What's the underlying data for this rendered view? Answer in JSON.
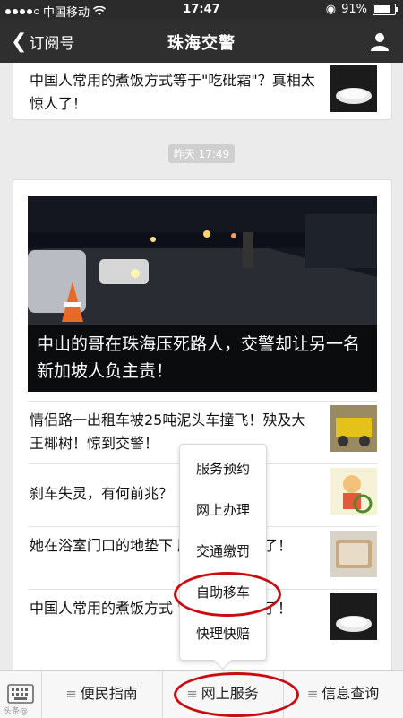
{
  "status_bar": {
    "carrier": "中国移动",
    "time": "17:47",
    "battery": "91%",
    "battery_level": 0.91
  },
  "navbar": {
    "back_label": "订阅号",
    "title": "珠海交警"
  },
  "top_card": {
    "title": "中国人常用的煮饭方式等于\"吃砒霜\"？真相太惊人了！"
  },
  "timestamp": "昨天 17:49",
  "hero": {
    "caption": "中山的哥在珠海压死路人，交警却让另一名新加坡人负主责！"
  },
  "articles": [
    {
      "title": "情侣路一出租车被25吨泥头车撞飞！殃及大王椰树！惊到交警！"
    },
    {
      "title": "刹车失灵，有何前兆？"
    },
    {
      "title": "她在浴室门口的地垫下                 膜，奇迹发生了！"
    },
    {
      "title": "中国人常用的煮饭方式                 \"?真相太惊人了！"
    }
  ],
  "popup_menu": {
    "items": [
      "服务预约",
      "网上办理",
      "交通缴罚",
      "自助移车",
      "快理快赔"
    ]
  },
  "bottom_menu": {
    "items": [
      "便民指南",
      "网上服务",
      "信息查询"
    ]
  },
  "watermark": "头条@",
  "colors": {
    "annotation": "#c80d12",
    "navbar": "#2f2f2f"
  }
}
